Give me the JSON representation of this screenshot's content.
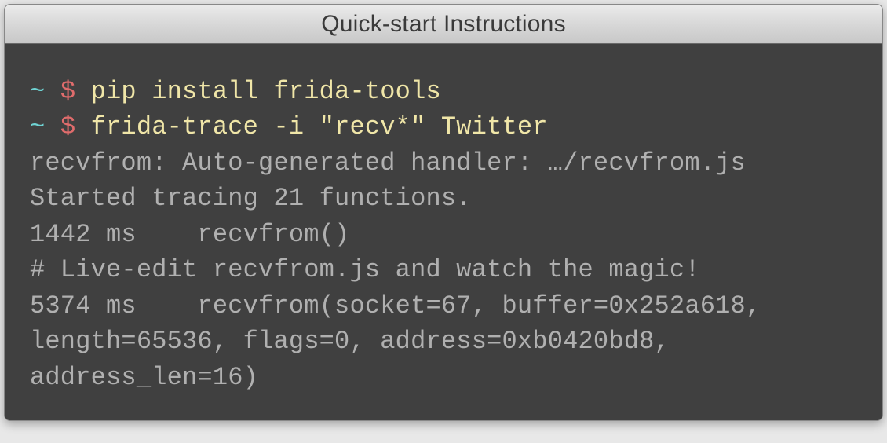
{
  "window": {
    "title": "Quick-start Instructions"
  },
  "terminal": {
    "lines": [
      {
        "prompt_tilde": "~",
        "prompt_dollar": "$",
        "command": "pip install frida-tools"
      },
      {
        "prompt_tilde": "~",
        "prompt_dollar": "$",
        "command": "frida-trace -i \"recv*\" Twitter"
      }
    ],
    "output": [
      "recvfrom: Auto-generated handler: …/recvfrom.js",
      "Started tracing 21 functions.",
      "1442 ms    recvfrom()",
      "# Live-edit recvfrom.js and watch the magic!",
      "5374 ms    recvfrom(socket=67, buffer=0x252a618, length=65536, flags=0, address=0xb0420bd8, address_len=16)"
    ]
  }
}
